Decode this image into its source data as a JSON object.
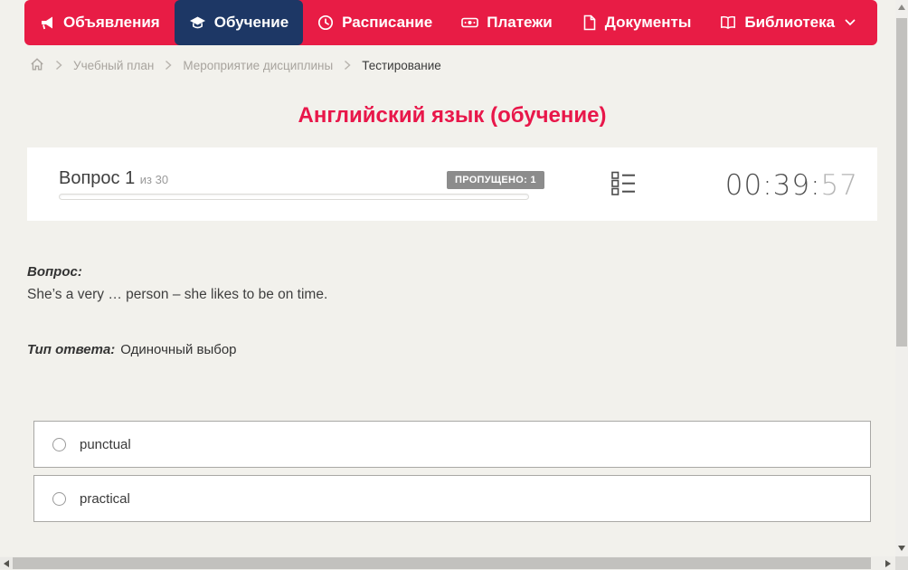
{
  "nav": {
    "items": [
      {
        "label": "Объявления",
        "icon": "megaphone-icon",
        "active": false
      },
      {
        "label": "Обучение",
        "icon": "graduation-cap-icon",
        "active": true
      },
      {
        "label": "Расписание",
        "icon": "clock-icon",
        "active": false
      },
      {
        "label": "Платежи",
        "icon": "banknote-icon",
        "active": false
      },
      {
        "label": "Документы",
        "icon": "document-icon",
        "active": false
      },
      {
        "label": "Библиотека",
        "icon": "open-book-icon",
        "active": false,
        "has_dropdown": true
      }
    ]
  },
  "breadcrumb": {
    "items": [
      "Учебный план",
      "Мероприятие дисциплины",
      "Тестирование"
    ]
  },
  "page": {
    "title": "Английский язык (обучение)"
  },
  "quiz": {
    "question_label": "Вопрос 1",
    "question_of": "из 30",
    "skipped_badge": "ПРОПУЩЕНО: 1",
    "progress_percent": 0,
    "timer": {
      "main": "00:39:",
      "seconds": "57"
    },
    "question_heading": "Вопрос:",
    "question_text": "She’s a very … person – she likes to be on time.",
    "answer_type_label": "Тип ответа:",
    "answer_type_value": "Одиночный выбор",
    "options": [
      {
        "label": "punctual",
        "selected": false
      },
      {
        "label": "practical",
        "selected": false
      }
    ]
  },
  "colors": {
    "brand_red": "#e81c45",
    "title_red": "#e8174a",
    "active_navy": "#1d3765",
    "page_bg": "#f2f1ec",
    "badge_gray": "#8c8c8c",
    "timer_dark": "#4f4f4f",
    "timer_light": "#b5b5b5"
  }
}
